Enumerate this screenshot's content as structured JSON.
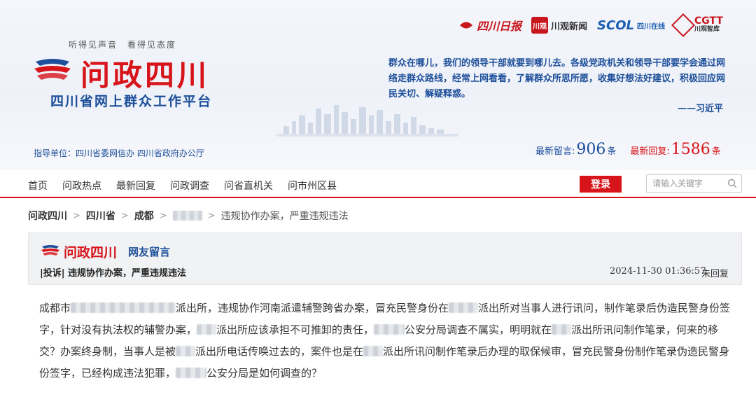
{
  "header": {
    "slogan": "听得见声音　看得见态度",
    "logo_text": "问政四川",
    "platform": "四川省网上群众工作平台",
    "guide": "指导单位：四川省委网信办 四川省政府办公厅",
    "partners": {
      "sc_daily": "四川日报",
      "cg_box": "川观",
      "cg_news": "川观新闻",
      "scol": "SCOL",
      "scol_sub": "四川在线",
      "cgtt": "CGTT",
      "cgtt_sub": "川观智库"
    },
    "quote": "群众在哪儿，我们的领导干部就要到哪儿去。各级党政机关和领导干部要学会通过网络走群众路线，经常上网看看，了解群众所思所愿，收集好想法好建议，积极回应网民关切、解疑释惑。",
    "quote_author": "——习近平",
    "counts": {
      "msg_label": "最新留言:",
      "msg_value": "906",
      "msg_unit": "条",
      "reply_label": "最新回复:",
      "reply_value": "1586",
      "reply_unit": "条"
    }
  },
  "nav": {
    "items": [
      "首页",
      "问政热点",
      "最新回复",
      "问政调查",
      "问省直机关",
      "问市州区县"
    ],
    "login": "登录",
    "search_placeholder": "请输入关键字"
  },
  "breadcrumb": {
    "c1": "问政四川",
    "c2": "四川省",
    "c3": "成都",
    "last": "违规协作办案，严重违规违法"
  },
  "panel": {
    "brand": "问政四川",
    "sub": "网友留言",
    "type": "|投诉| 违规协作办案，严重违规违法",
    "time": "2024-11-30 01:36:57",
    "status": "未回复"
  },
  "content": {
    "s1": "成都市",
    "s2": "派出所，违规协作河南派遣辅警跨省办案，冒充民警身份在",
    "s3": "派出所对当事人进行讯问，制作笔录后伪造民警身份签字，针对没有执法权的辅警办案，",
    "s4": "派出所应该承担不可推卸的责任，",
    "s5": "公安分局调查不属实，明明就在",
    "s6": "派出所讯问制作笔录，何来的移交？办案终身制，当事人是被",
    "s7": "派出所电话传唤过去的，案件也是在",
    "s8": "派出所讯问制作笔录后办理的取保候审，冒充民警身份制作笔录伪造民警身份签字，已经构成违法犯罪，",
    "s9": "公安分局是如何调查的？"
  },
  "colors": {
    "brand_red": "#d7141a",
    "brand_blue": "#1d4f9a"
  }
}
